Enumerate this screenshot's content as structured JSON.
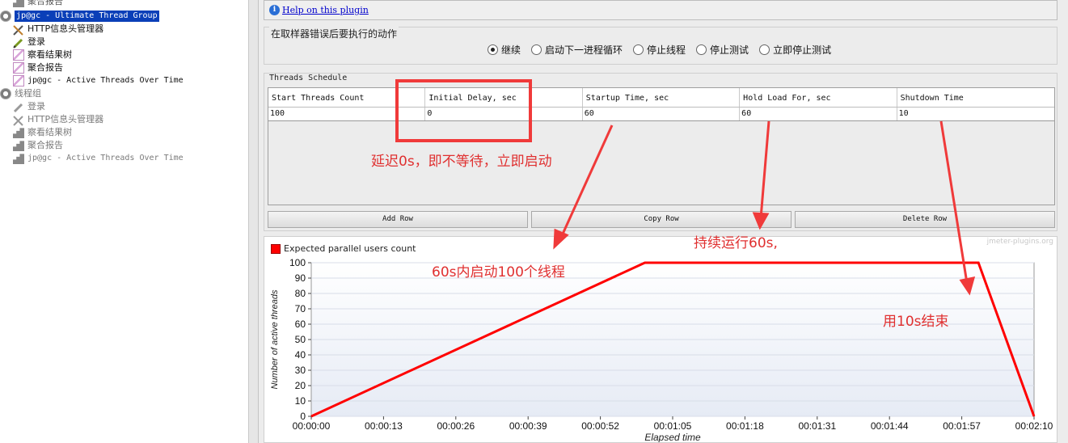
{
  "tree": {
    "items": [
      {
        "label": "聚合报告",
        "icon": "aggregate-report-icon",
        "dim": false
      },
      {
        "label": "jp@gc - Ultimate Thread Group",
        "icon": "thread-group-gear-icon",
        "selected": true
      },
      {
        "label": "HTTP信息头管理器",
        "icon": "tools-icon"
      },
      {
        "label": "登录",
        "icon": "pencil-icon"
      },
      {
        "label": "察看结果树",
        "icon": "chart-icon"
      },
      {
        "label": "聚合报告",
        "icon": "chart-icon"
      },
      {
        "label": "jp@gc - Active Threads Over Time",
        "icon": "chart-icon"
      },
      {
        "label": "线程组",
        "icon": "gear-icon",
        "dim": true
      },
      {
        "label": "登录",
        "icon": "pencil-icon",
        "dim": true
      },
      {
        "label": "HTTP信息头管理器",
        "icon": "tools-icon",
        "dim": true
      },
      {
        "label": "察看结果树",
        "icon": "bar-chart-icon",
        "dim": true
      },
      {
        "label": "聚合报告",
        "icon": "bar-chart-icon",
        "dim": true
      },
      {
        "label": "jp@gc - Active Threads Over Time",
        "icon": "bar-chart-icon",
        "dim": true
      }
    ]
  },
  "help": {
    "link": "Help on this plugin"
  },
  "error_action": {
    "title": "在取样器错误后要执行的动作",
    "options": [
      "继续",
      "启动下一进程循环",
      "停止线程",
      "停止测试",
      "立即停止测试"
    ],
    "selected": "继续"
  },
  "schedule": {
    "title": "Threads Schedule",
    "columns": [
      "Start Threads Count",
      "Initial Delay, sec",
      "Startup Time, sec",
      "Hold Load For, sec",
      "Shutdown Time"
    ],
    "row": [
      "100",
      "0",
      "60",
      "60",
      "10"
    ],
    "buttons": {
      "add": "Add Row",
      "copy": "Copy Row",
      "delete": "Delete Row"
    }
  },
  "annotations": {
    "delay": "延迟0s，即不等待，立即启动",
    "startup": "60s内启动100个线程",
    "hold": "持续运行60s,",
    "shutdown": "用10s结束"
  },
  "chart_data": {
    "type": "line",
    "title": "",
    "watermark": "jmeter-plugins.org",
    "legend": "Expected parallel users count",
    "xlabel": "Elapsed time",
    "ylabel": "Number of active threads",
    "x_ticks": [
      "00:00:00",
      "00:00:13",
      "00:00:26",
      "00:00:39",
      "00:00:52",
      "00:01:05",
      "00:01:18",
      "00:01:31",
      "00:01:44",
      "00:01:57",
      "00:02:10"
    ],
    "y_ticks": [
      0,
      10,
      20,
      30,
      40,
      50,
      60,
      70,
      80,
      90,
      100
    ],
    "xlim_seconds": [
      0,
      130
    ],
    "ylim": [
      0,
      100
    ],
    "series": [
      {
        "name": "Expected parallel users count",
        "color": "#ff0000",
        "x_seconds": [
          0,
          60,
          120,
          130
        ],
        "y": [
          0,
          100,
          100,
          0
        ]
      }
    ]
  }
}
